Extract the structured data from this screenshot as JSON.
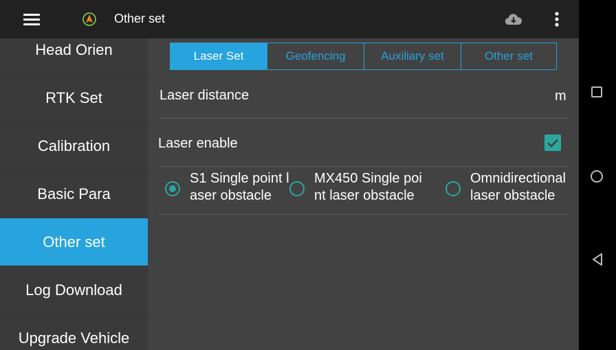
{
  "header": {
    "title": "Other set",
    "icons": [
      "menu-icon",
      "navigation-arrow-icon",
      "cloud-download-icon",
      "more-vert-icon"
    ]
  },
  "sidebar": {
    "items": [
      {
        "label": "Head Orien",
        "active": false
      },
      {
        "label": "RTK Set",
        "active": false
      },
      {
        "label": "Calibration",
        "active": false
      },
      {
        "label": "Basic Para",
        "active": false
      },
      {
        "label": "Other set",
        "active": true
      },
      {
        "label": "Log Download",
        "active": false
      },
      {
        "label": "Upgrade Vehicle",
        "active": false
      }
    ]
  },
  "tabs": [
    {
      "label": "Laser Set",
      "active": true
    },
    {
      "label": "Geofencing",
      "active": false
    },
    {
      "label": "Auxiliary set",
      "active": false
    },
    {
      "label": "Other set",
      "active": false
    }
  ],
  "laser_set": {
    "distance_label": "Laser distance",
    "distance_value": "",
    "distance_unit": "m",
    "enable_label": "Laser enable",
    "enable_checked": true,
    "obstacle_options": [
      {
        "label": "S1 Single point laser obstacle",
        "selected": true
      },
      {
        "label": "MX450 Single point laser obstacle",
        "selected": false
      },
      {
        "label": "Omnidirectional laser obstacle",
        "selected": false
      }
    ]
  },
  "colors": {
    "accent": "#27a3dd",
    "check": "#2aa8a0",
    "background": "#424242",
    "topbar": "#212121",
    "logo": "#e8862a"
  }
}
